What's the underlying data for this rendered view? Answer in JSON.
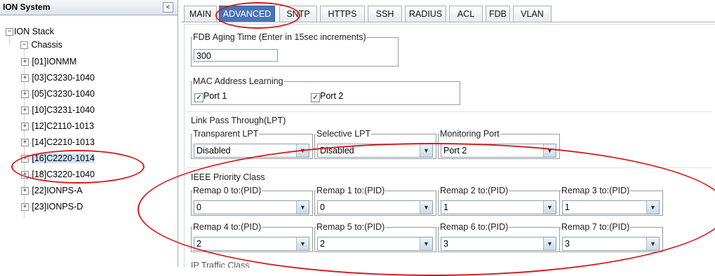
{
  "tree": {
    "header": "ION System",
    "collapse_glyph": "<",
    "root": "ION Stack",
    "chassis": "Chassis",
    "items": [
      "[01]IONMM",
      "[03]C3230-1040",
      "[05]C3230-1040",
      "[10]C3231-1040",
      "[12]C2110-1013",
      "[14]C2210-1013",
      "[16]C2220-1014",
      "[18]C3220-1040",
      "[22]IONPS-A",
      "[23]IONPS-D"
    ],
    "selected": "[16]C2220-1014"
  },
  "tabs": [
    "MAIN",
    "ADVANCED",
    "SNTP",
    "HTTPS",
    "SSH",
    "RADIUS",
    "ACL",
    "FDB",
    "VLAN"
  ],
  "active_tab": "ADVANCED",
  "fdb": {
    "legend": "FDB Aging Time (Enter in 15sec increments)",
    "value": "300"
  },
  "mac": {
    "legend": "MAC Address Learning",
    "ports": [
      {
        "label": "Port 1",
        "checked": true
      },
      {
        "label": "Port 2",
        "checked": true
      }
    ]
  },
  "lpt": {
    "title": "Link Pass Through(LPT)",
    "transparent": {
      "legend": "Transparent LPT",
      "value": "Disabled"
    },
    "selective": {
      "legend": "Selective LPT",
      "value": "Disabled"
    },
    "monitoring": {
      "legend": "Monitoring Port",
      "value": "Port 2"
    }
  },
  "ieee": {
    "title": "IEEE Priority Class",
    "remaps": [
      {
        "legend": "Remap 0 to:(PID)",
        "value": "0"
      },
      {
        "legend": "Remap 1 to:(PID)",
        "value": "0"
      },
      {
        "legend": "Remap 2 to:(PID)",
        "value": "1"
      },
      {
        "legend": "Remap 3 to:(PID)",
        "value": "1"
      },
      {
        "legend": "Remap 4 to:(PID)",
        "value": "2"
      },
      {
        "legend": "Remap 5 to:(PID)",
        "value": "2"
      },
      {
        "legend": "Remap 6 to:(PID)",
        "value": "3"
      },
      {
        "legend": "Remap 7 to:(PID)",
        "value": "3"
      }
    ]
  },
  "partial_text": "IP Traffic Class",
  "colors": {
    "accent": "#4a74b6",
    "annotation": "#d9181b",
    "check": "#1b7a1b"
  }
}
